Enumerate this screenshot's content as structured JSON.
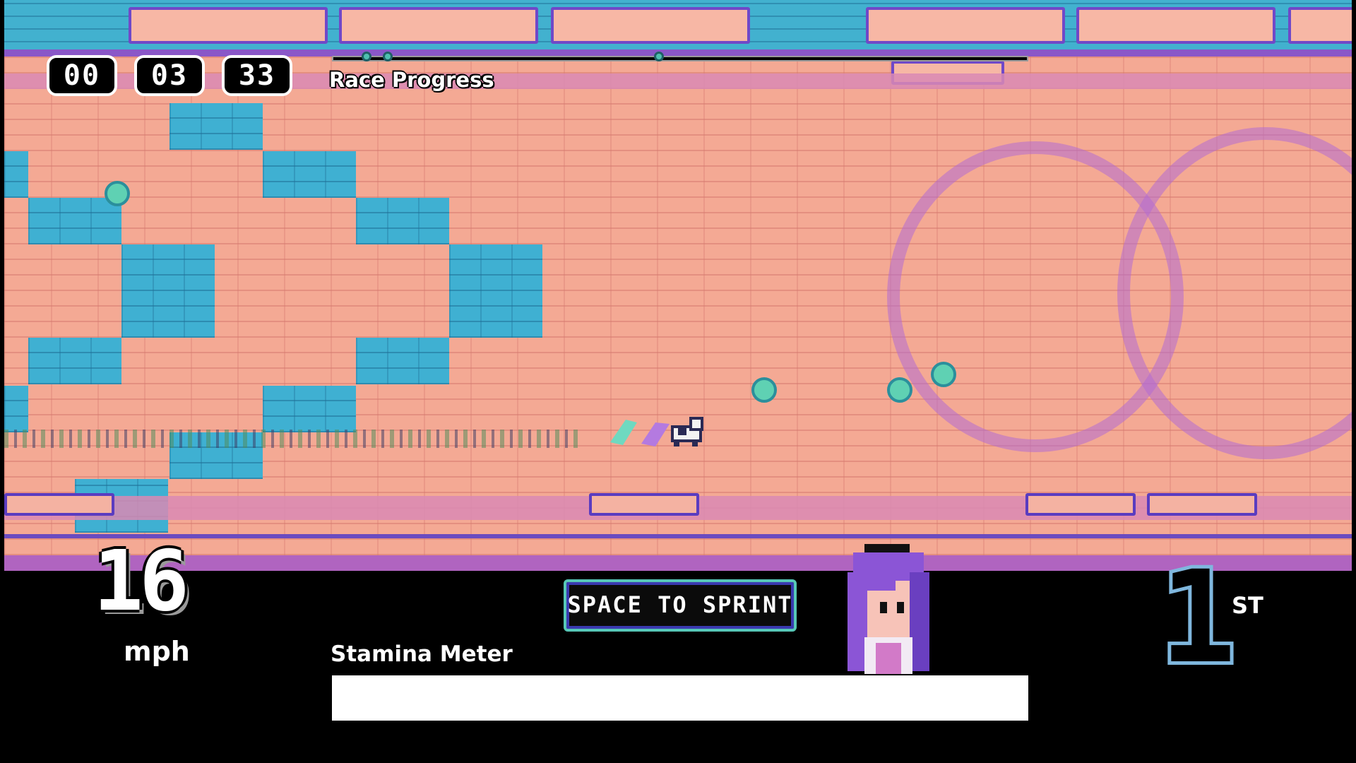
{
  "timer": {
    "minutes": "00",
    "seconds": "03",
    "centiseconds": "33"
  },
  "race_progress": {
    "label": "Race Progress",
    "player_progress": 0.05,
    "rival_progress": [
      0.08,
      0.47
    ]
  },
  "speed": {
    "value": "16",
    "unit": "mph"
  },
  "sprint_prompt": {
    "label": "SPACE TO SPRINT"
  },
  "stamina": {
    "label": "Stamina Meter",
    "level": 1.0
  },
  "placement": {
    "number": "1",
    "suffix": "ST"
  },
  "colors": {
    "brick": "#f4a994",
    "tile_blue": "#3fb0d2",
    "accent_purple": "#7048c8",
    "bubble": "#5fd1b3",
    "place_outline": "#7fb7de"
  },
  "icons": {
    "runner": "racing-dog-sprite",
    "portrait": "purple-haired-girl-portrait"
  }
}
